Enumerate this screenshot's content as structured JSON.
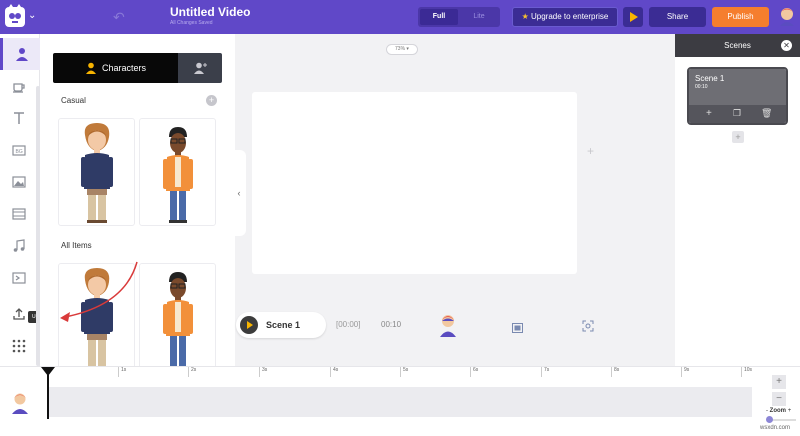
{
  "header": {
    "title": "Untitled Video",
    "subtitle": "All Changes Saved",
    "mode_full": "Full",
    "mode_lite": "Lite",
    "upgrade_label": "Upgrade to enterprise",
    "share_label": "Share",
    "publish_label": "Publish"
  },
  "colors": {
    "brand": "#6048c8",
    "publish": "#f57e2e",
    "play_accent": "#f8b400"
  },
  "sidebar": {
    "items": [
      {
        "name": "characters",
        "icon": "character-icon",
        "active": true
      },
      {
        "name": "properties",
        "icon": "coffee-icon"
      },
      {
        "name": "text",
        "icon": "text-icon"
      },
      {
        "name": "backgrounds",
        "icon": "bg-icon"
      },
      {
        "name": "images",
        "icon": "image-icon"
      },
      {
        "name": "videos",
        "icon": "video-icon"
      },
      {
        "name": "music",
        "icon": "music-icon"
      },
      {
        "name": "effects",
        "icon": "effects-icon"
      },
      {
        "name": "uploads",
        "icon": "upload-icon"
      },
      {
        "name": "more",
        "icon": "grid-icon"
      }
    ],
    "uploads_tooltip": "Uploads"
  },
  "library": {
    "tab_characters": "Characters",
    "section_casual": "Casual",
    "section_all": "All Items"
  },
  "canvas": {
    "zoom_level": "73%"
  },
  "scene_bar": {
    "scene_label": "Scene 1",
    "start_time": "[00:00]",
    "duration": "00:10"
  },
  "scenes_panel": {
    "title": "Scenes",
    "scene_name": "Scene 1",
    "scene_duration": "00:10"
  },
  "timeline": {
    "ticks": [
      "1s",
      "2s",
      "3s",
      "4s",
      "5s",
      "6s",
      "7s",
      "8s",
      "9s",
      "10s"
    ],
    "zoom_label": "Zoom",
    "zoom_minus": "-",
    "zoom_plus": "+",
    "watermark": "wsxdn.com"
  }
}
